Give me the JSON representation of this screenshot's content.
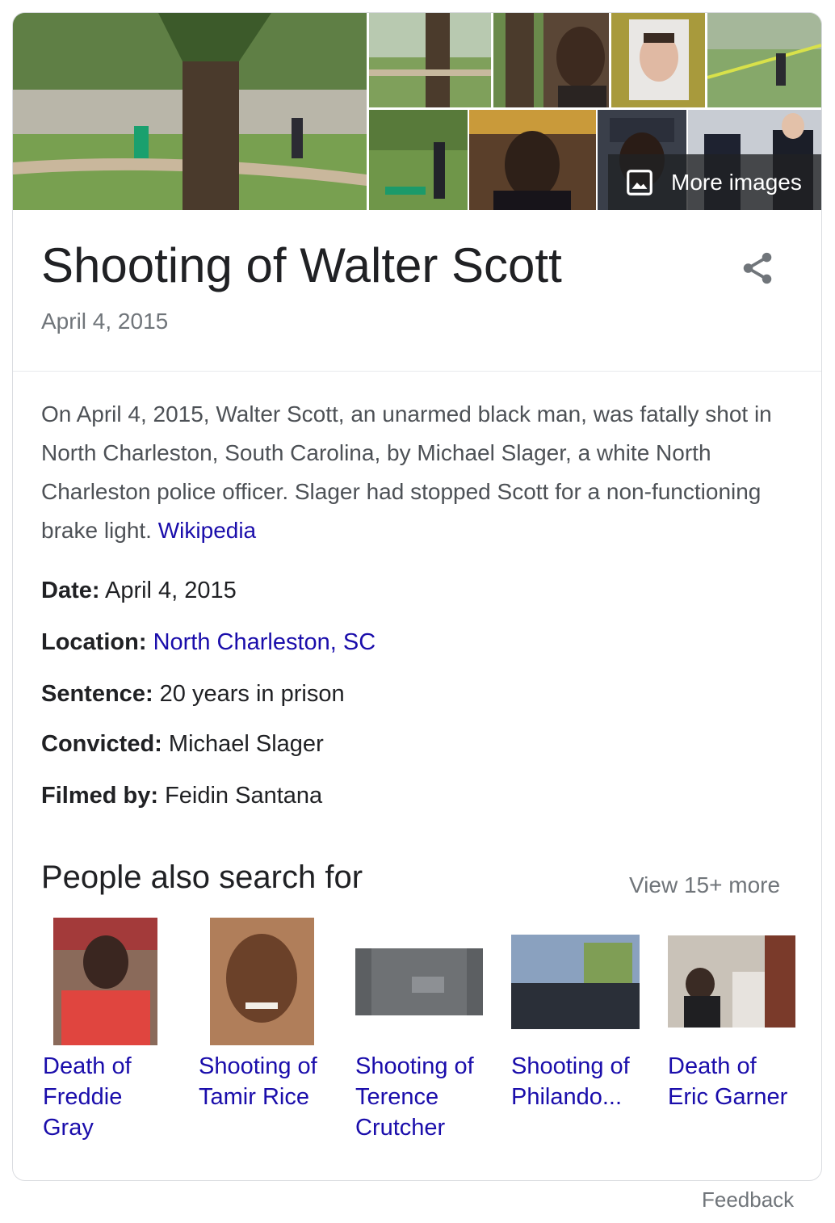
{
  "gallery": {
    "more_images_label": "More images",
    "colors": {
      "grass": "#6f9a4a",
      "tree": "#4a3a2c",
      "sky": "#c7d3c4"
    }
  },
  "header": {
    "title": "Shooting of Walter Scott",
    "subtitle": "April 4, 2015",
    "share_icon": "share-icon"
  },
  "description": {
    "text": "On April 4, 2015, Walter Scott, an unarmed black man, was fatally shot in North Charleston, South Carolina, by Michael Slager, a white North Charleston police officer. Slager had stopped Scott for a non-functioning brake light.",
    "source_link": "Wikipedia"
  },
  "facts": [
    {
      "label": "Date:",
      "value": "April 4, 2015",
      "is_link": false
    },
    {
      "label": "Location:",
      "value": "North Charleston, SC",
      "is_link": true
    },
    {
      "label": "Sentence:",
      "value": "20 years in prison",
      "is_link": false
    },
    {
      "label": "Convicted:",
      "value": "Michael Slager",
      "is_link": false
    },
    {
      "label": "Filmed by:",
      "value": "Feidin Santana",
      "is_link": false
    }
  ],
  "people_also_search": {
    "heading": "People also search for",
    "view_more": "View 15+ more",
    "items": [
      {
        "line1": "Death of",
        "line2": "Freddie",
        "line3": "Gray"
      },
      {
        "line1": "Shooting of",
        "line2": "Tamir Rice",
        "line3": ""
      },
      {
        "line1": "Shooting of",
        "line2": "Terence",
        "line3": "Crutcher"
      },
      {
        "line1": "Shooting of",
        "line2": "Philando...",
        "line3": ""
      },
      {
        "line1": "Death of",
        "line2": "Eric Garner",
        "line3": ""
      }
    ]
  },
  "footer": {
    "feedback": "Feedback"
  },
  "colors": {
    "link": "#1a0dab",
    "muted": "#70757a",
    "text": "#202124",
    "border": "#dadce0"
  }
}
